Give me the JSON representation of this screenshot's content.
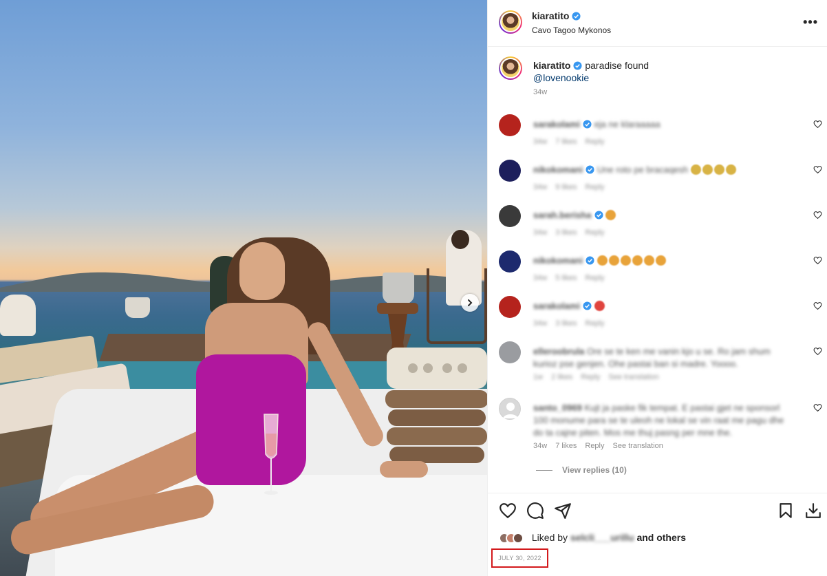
{
  "post": {
    "username": "kiaratito",
    "location": "Cavo Tagoo Mykonos",
    "more_label": "•••"
  },
  "caption": {
    "username": "kiaratito",
    "text": "paradise found",
    "mention": "@lovenookie",
    "time": "34w"
  },
  "comments": [
    {
      "username": "sarakolami",
      "text": "eja ne klaraaaaa",
      "time": "34w",
      "likes": "7 likes",
      "reply": "Reply",
      "see_translation": "",
      "avatar_color": "#b5231d"
    },
    {
      "username": "nikokomani",
      "text": "Une roto pe bracaqesh",
      "time": "34w",
      "likes": "9 likes",
      "reply": "Reply",
      "see_translation": "",
      "avatar_color": "#1d1f5c"
    },
    {
      "username": "sarah.berisha",
      "text": "",
      "time": "34w",
      "likes": "3 likes",
      "reply": "Reply",
      "see_translation": "",
      "avatar_color": "#3a3a3a"
    },
    {
      "username": "nikokomani",
      "text": "",
      "time": "34w",
      "likes": "5 likes",
      "reply": "Reply",
      "see_translation": "",
      "avatar_color": "#1d2a6e"
    },
    {
      "username": "sarakolami",
      "text": "",
      "time": "34w",
      "likes": "3 likes",
      "reply": "Reply",
      "see_translation": "",
      "avatar_color": "#b5231d"
    },
    {
      "username": "elleroobrula",
      "text": "Ore se te ken me vanin kjo u se. Ro jam shum kurioz pse genjen. Ohe pastai ban si madre. Yoooo.",
      "time": "1w",
      "likes": "2 likes",
      "reply": "Reply",
      "see_translation": "See translation",
      "avatar_color": "#9a9ca0"
    },
    {
      "username": "santo_0969",
      "text": "Kujt ja paske fik tempat. E pastai gjet ne sponsorl 100 monume para se te uleoh ne lokal se vin raat me pagu dhe do ta cajne piten. Mos me thuj pasng per mne the.",
      "time": "34w",
      "likes": "7 likes",
      "reply": "Reply",
      "see_translation": "See translation",
      "avatar_color": "#d9d9d9"
    }
  ],
  "view_replies": "View replies (10)",
  "likes": {
    "prefix": "Liked by",
    "user": "selcli___urillu",
    "suffix": "and others"
  },
  "date": "JULY 30, 2022"
}
